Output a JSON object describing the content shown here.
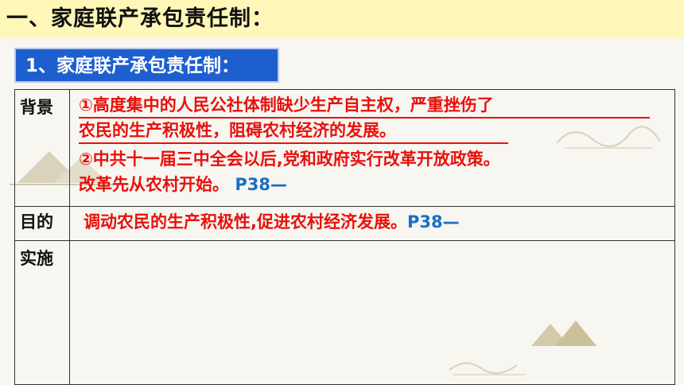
{
  "title": "一、家庭联产承包责任制：",
  "subtitle": "1、家庭联产承包责任制：",
  "rows": [
    {
      "label": "背景",
      "lines": [
        "①高度集中的人民公社体制缺少生产自主权，严重挫伤了",
        "农民的生产积极性，阻碍农村经济的发展。",
        "②中共十一届三中全会以后,党和政府实行改革开放政策。",
        "改革先从农村开始。"
      ],
      "ref": "P38—"
    },
    {
      "label": "目的",
      "line": "调动农民的生产积极性,促进农村经济发展。",
      "ref": "P38—"
    },
    {
      "label": "实施"
    }
  ],
  "colors": {
    "title_background": "#fef7b8",
    "subtitle_background": "#1e5fd0",
    "content_text": "#e8100c",
    "reference_text": "#1a6fc4"
  },
  "icons": [
    "mountain-decoration-icon",
    "cloud-swirl-decoration-icon"
  ]
}
